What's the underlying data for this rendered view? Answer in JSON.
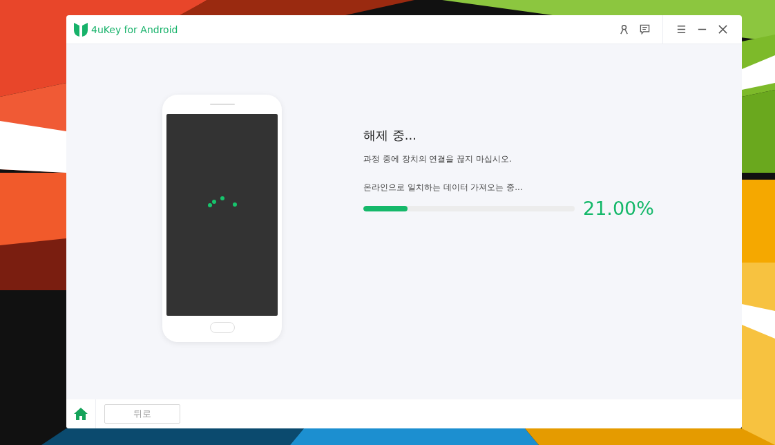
{
  "window": {
    "title": "4uKey for Android"
  },
  "status": {
    "heading": "해제 중...",
    "warning": "과정 중에 장치의 연결을 끊지 마십시오.",
    "step": "온라인으로 일치하는 데이터 가져오는 중...",
    "level": 0.21,
    "reading": "21.00%"
  },
  "footer": {
    "back_button": {
      "label": "뒤로",
      "disabled": true
    }
  }
}
